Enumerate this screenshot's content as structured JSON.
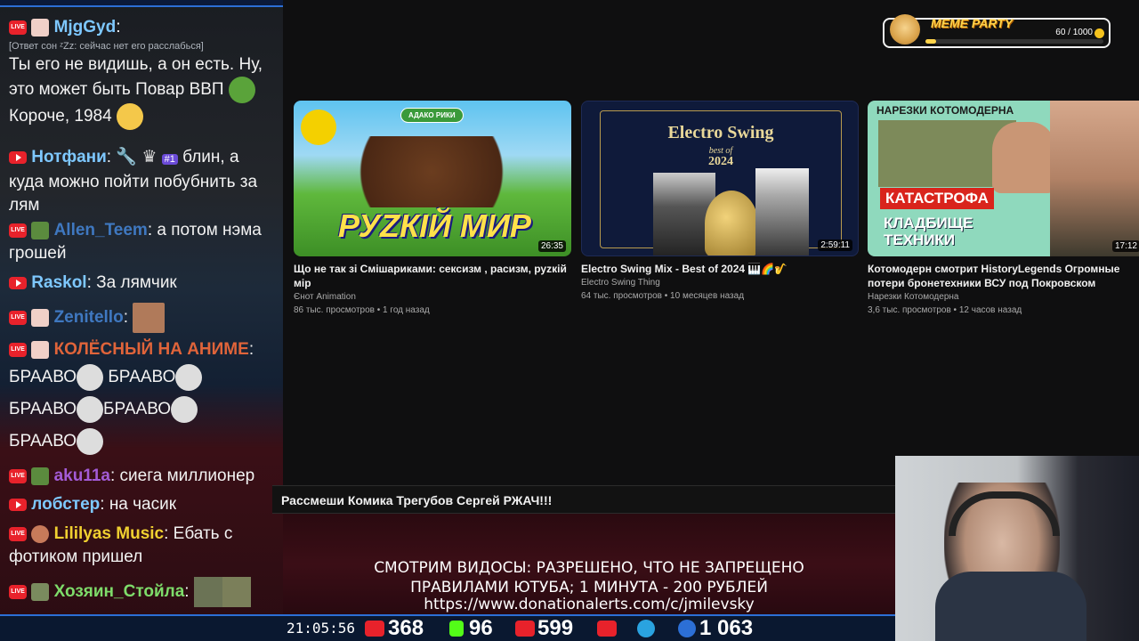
{
  "chat": {
    "messages": [
      {
        "user": "MjgGyd",
        "reply": "[Ответ сон ᶻZz: сейчас нет его расслабься]",
        "text": "Ты его не видишь, а он есть. Ну, это может быть Повар ВВП",
        "text2": "Короче, 1984"
      },
      {
        "user": "Нотфани",
        "badge": "#1",
        "text": "блин, а куда можно пойти побубнить за лям"
      },
      {
        "user": "Allen_Teem",
        "text": "а потом нэма грошей"
      },
      {
        "user": "Raskol",
        "text": "За лямчик"
      },
      {
        "user": "Zenitello",
        "text": ""
      },
      {
        "user": "КОЛЁСНЫЙ НА АНИМЕ",
        "lines": [
          "БРААВО",
          "БРААВО",
          "БРААВО",
          "БРААВО",
          "БРААВО"
        ]
      },
      {
        "user": "aku11a",
        "text": "сиега миллионер"
      },
      {
        "user": "лобстер",
        "text": "на часик"
      },
      {
        "user": "Lililyas Music",
        "text": "Ебать с фотиком пришел"
      },
      {
        "user": "Хозяин_Стойла",
        "text": ""
      }
    ]
  },
  "videos": [
    {
      "title": "Що не так зі Смішариками: сексизм , расизм, руzкій мір",
      "channel": "Єнот Animation",
      "stats": "86 тыс. просмотров • 1 год назад",
      "duration": "26:35",
      "thumb_text": "РУZКІЙ МИР",
      "thumb_badge": "АДАКО РИКИ"
    },
    {
      "title": "Electro Swing Mix - Best of 2024 🎹🌈🎷",
      "channel": "Electro Swing Thing",
      "stats": "64 тыс. просмотров • 10 месяцев назад",
      "duration": "2:59:11",
      "thumb_text": "Electro Swing",
      "thumb_sub": "best of",
      "thumb_year": "2024"
    },
    {
      "title": "Котомодерн смотрит HistoryLegends Огромные потери бронетехники ВСУ под Покровском",
      "channel": "Нарезки Котомодерна",
      "stats": "3,6 тыс. просмотров • 12 часов назад",
      "duration": "17:12",
      "thumb_header": "НАРЕЗКИ КОТОМОДЕРНА",
      "thumb_red": "КАТАСТРОФА",
      "thumb_text": "КЛАДБИЩЕ ТЕХНИКИ"
    }
  ],
  "meme_party": {
    "title": "MEME PARTY",
    "count": "60 / 1000",
    "progress": 0.06
  },
  "ticker": "Рассмеши Комика Трегубов Сергей РЖАЧ!!!",
  "rules": {
    "line1": "СМОТРИМ ВИДОСЫ: РАЗРЕШЕНО, ЧТО НЕ ЗАПРЕЩЕНО",
    "line2": "ПРАВИЛАМИ ЮТУБА; 1 МИНУТА - 200 РУБЛЕЙ",
    "line3": "https://www.donationalerts.com/c/jmilevsky"
  },
  "bottom": {
    "clock": "21:05:56",
    "youtube": "368",
    "kick": "96",
    "vk": "599",
    "viewers": "1 063"
  },
  "colors": {
    "youtube": "#e8222b",
    "kick": "#53fc18",
    "telegram": "#2aa3e0",
    "accent": "#2c6fd6"
  },
  "live_label": "LIVE"
}
